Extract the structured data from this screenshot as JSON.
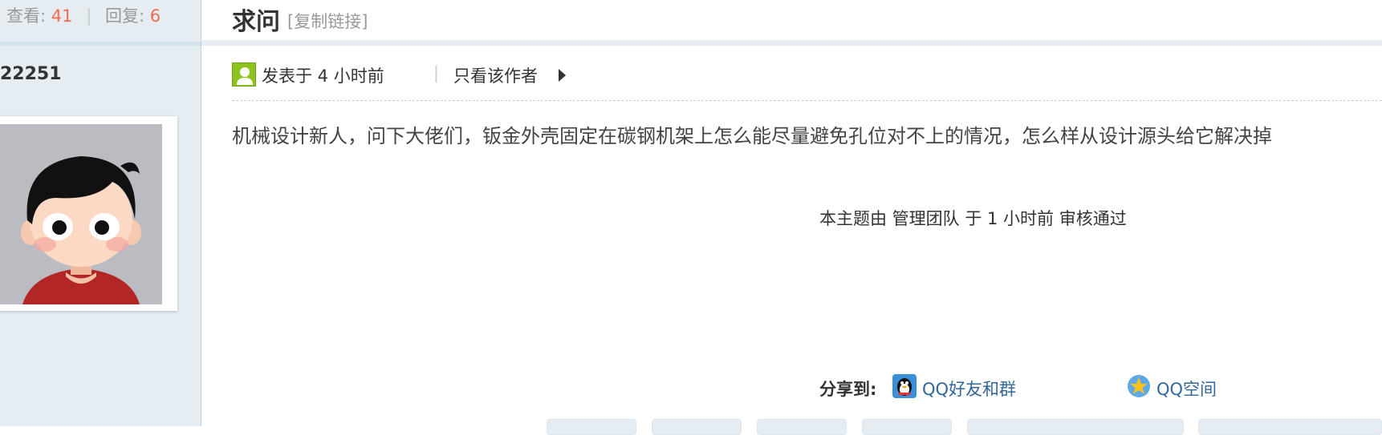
{
  "stats": {
    "views_label": "查看:",
    "views_value": "41",
    "separator": "|",
    "replies_label": "回复:",
    "replies_value": "6"
  },
  "author": {
    "uid_partial": "22251"
  },
  "thread": {
    "title": "求问",
    "copy_link": "[复制链接]"
  },
  "post": {
    "posted_text": "发表于 4 小时前",
    "separator": "|",
    "only_author": "只看该作者",
    "content": "机械设计新人，问下大佬们，钣金外壳固定在碳钢机架上怎么能尽量避免孔位对不上的情况，怎么样从设计源头给它解决掉",
    "audit_note": "本主题由 管理团队 于 1 小时前 审核通过"
  },
  "share": {
    "label": "分享到:",
    "qq_label": "QQ好友和群",
    "qq_icon": "qq-penguin-icon",
    "qzone_label": "QQ空间",
    "qzone_icon": "qzone-star-icon"
  },
  "colors": {
    "accent_number": "#f26c4f",
    "link": "#336699",
    "side_bg": "#e5edf2",
    "user_icon": "#8ec31f"
  }
}
